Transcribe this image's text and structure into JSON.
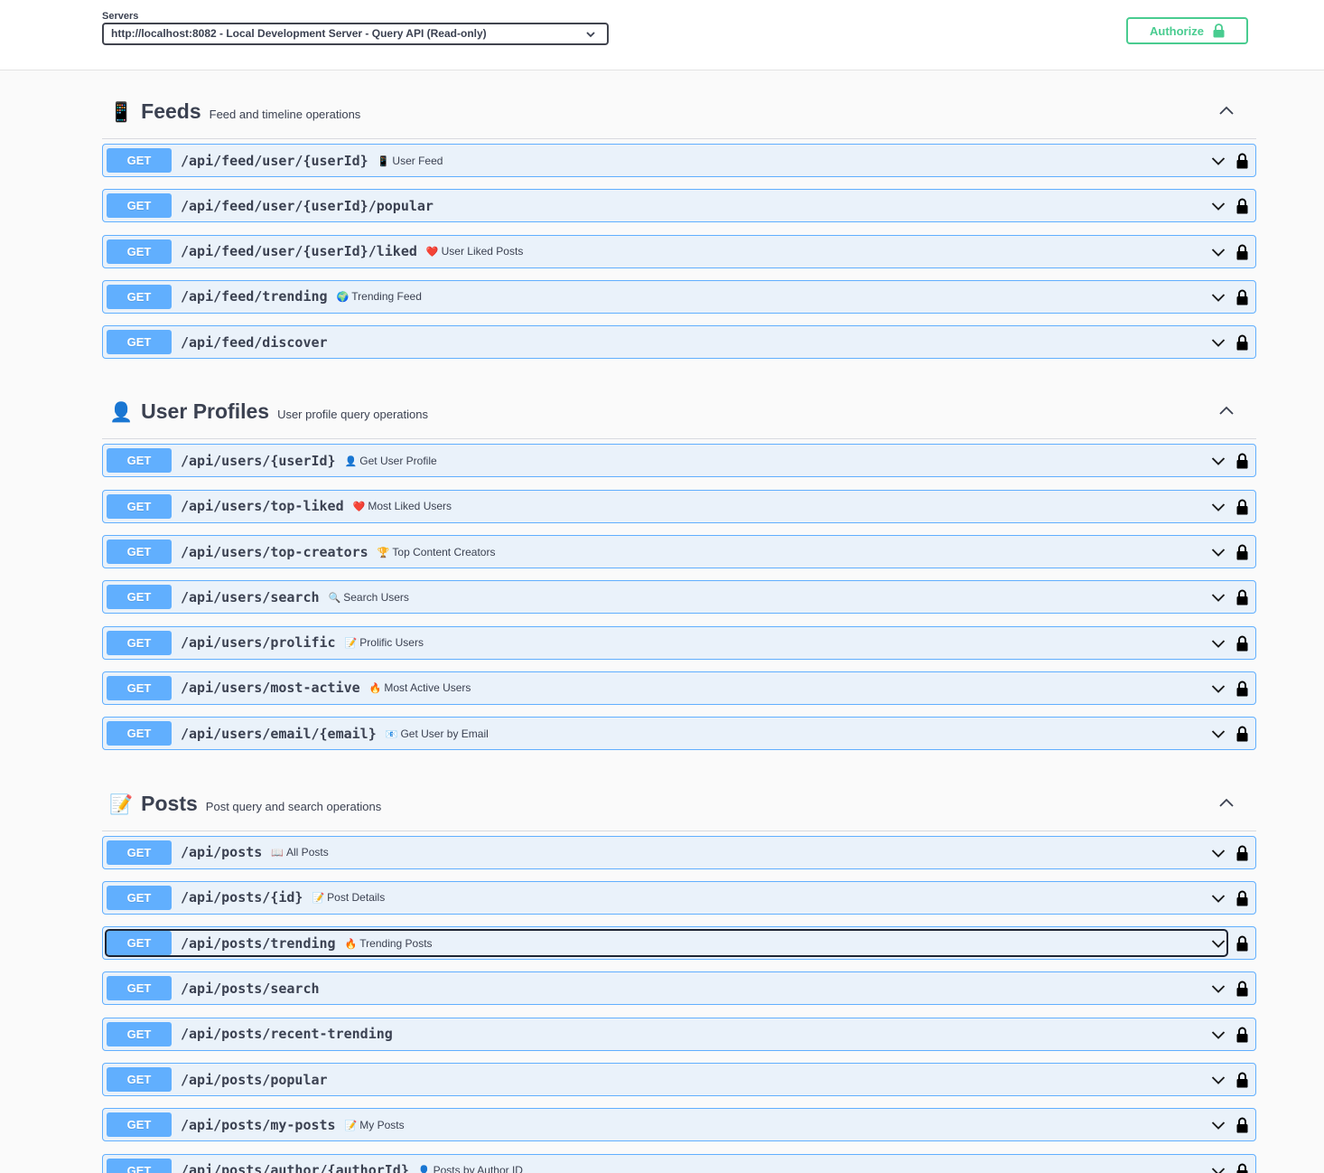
{
  "servers": {
    "label": "Servers",
    "selected": "http://localhost:8082 - Local Development Server - Query API (Read-only)"
  },
  "authorize": {
    "label": "Authorize"
  },
  "sections": [
    {
      "emoji": "📱",
      "name": "Feeds",
      "description": "Feed and timeline operations",
      "operations": [
        {
          "method": "GET",
          "path": "/api/feed/user/{userId}",
          "emoji": "📱",
          "summary": "User Feed"
        },
        {
          "method": "GET",
          "path": "/api/feed/user/{userId}/popular",
          "emoji": "",
          "summary": ""
        },
        {
          "method": "GET",
          "path": "/api/feed/user/{userId}/liked",
          "emoji": "❤️",
          "summary": "User Liked Posts"
        },
        {
          "method": "GET",
          "path": "/api/feed/trending",
          "emoji": "🌍",
          "summary": "Trending Feed"
        },
        {
          "method": "GET",
          "path": "/api/feed/discover",
          "emoji": "",
          "summary": ""
        }
      ]
    },
    {
      "emoji": "👤",
      "name": "User Profiles",
      "description": "User profile query operations",
      "operations": [
        {
          "method": "GET",
          "path": "/api/users/{userId}",
          "emoji": "👤",
          "summary": "Get User Profile"
        },
        {
          "method": "GET",
          "path": "/api/users/top-liked",
          "emoji": "❤️",
          "summary": "Most Liked Users"
        },
        {
          "method": "GET",
          "path": "/api/users/top-creators",
          "emoji": "🏆",
          "summary": "Top Content Creators"
        },
        {
          "method": "GET",
          "path": "/api/users/search",
          "emoji": "🔍",
          "summary": "Search Users"
        },
        {
          "method": "GET",
          "path": "/api/users/prolific",
          "emoji": "📝",
          "summary": "Prolific Users"
        },
        {
          "method": "GET",
          "path": "/api/users/most-active",
          "emoji": "🔥",
          "summary": "Most Active Users"
        },
        {
          "method": "GET",
          "path": "/api/users/email/{email}",
          "emoji": "📧",
          "summary": "Get User by Email"
        }
      ]
    },
    {
      "emoji": "📝",
      "name": "Posts",
      "description": "Post query and search operations",
      "operations": [
        {
          "method": "GET",
          "path": "/api/posts",
          "emoji": "📖",
          "summary": "All Posts"
        },
        {
          "method": "GET",
          "path": "/api/posts/{id}",
          "emoji": "📝",
          "summary": "Post Details"
        },
        {
          "method": "GET",
          "path": "/api/posts/trending",
          "emoji": "🔥",
          "summary": "Trending Posts",
          "focused": true
        },
        {
          "method": "GET",
          "path": "/api/posts/search",
          "emoji": "",
          "summary": ""
        },
        {
          "method": "GET",
          "path": "/api/posts/recent-trending",
          "emoji": "",
          "summary": ""
        },
        {
          "method": "GET",
          "path": "/api/posts/popular",
          "emoji": "",
          "summary": ""
        },
        {
          "method": "GET",
          "path": "/api/posts/my-posts",
          "emoji": "📝",
          "summary": "My Posts"
        },
        {
          "method": "GET",
          "path": "/api/posts/author/{authorId}",
          "emoji": "👤",
          "summary": "Posts by Author ID"
        }
      ]
    }
  ]
}
